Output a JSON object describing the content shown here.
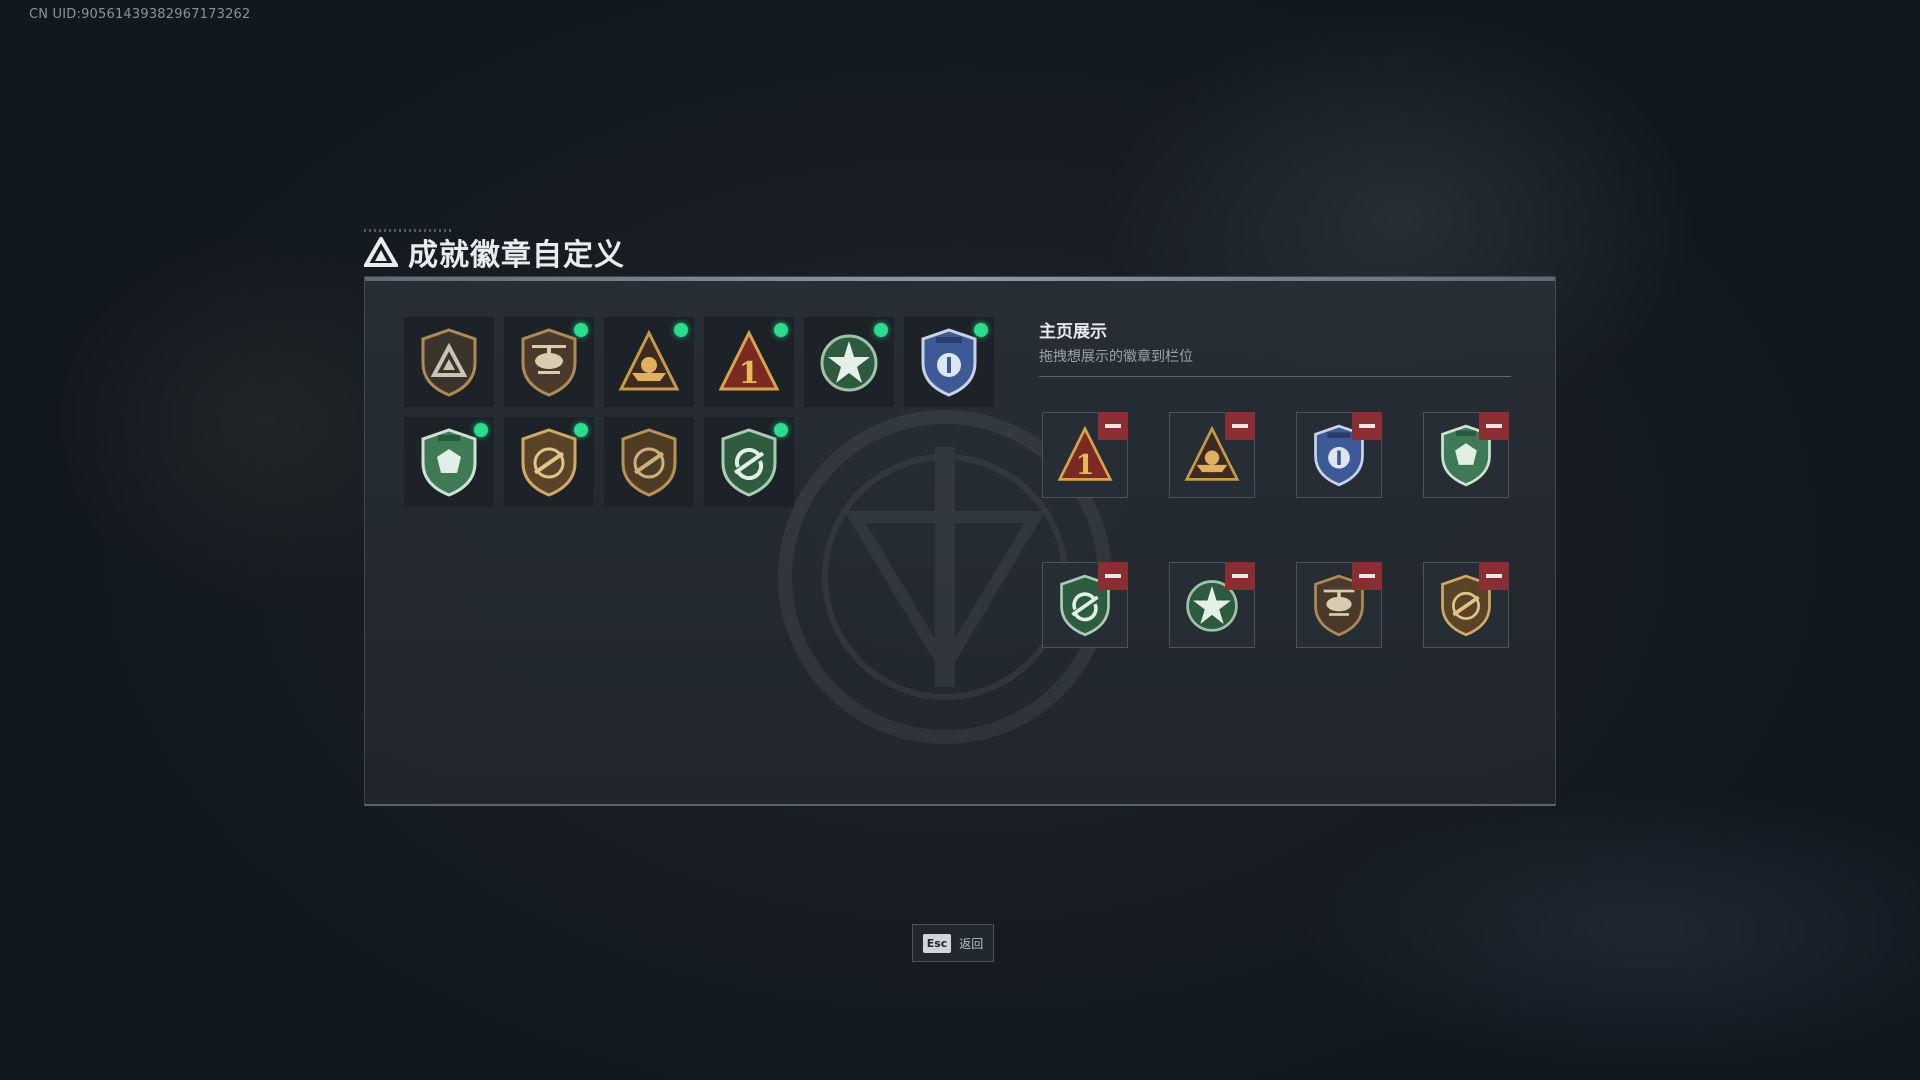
{
  "uid_text": "CN UID:9056143938296​7173262",
  "title": "成就徽章自定义",
  "showcase": {
    "title": "主页展示",
    "subtitle": "拖拽想展示的徽章到栏位"
  },
  "esc": {
    "key": "Esc",
    "label": "返回"
  },
  "colors": {
    "new_dot": "#2bdc8c",
    "remove": "#8b2e33",
    "bronze": "#b08a55",
    "green": "#3e7a55",
    "blue": "#3e5a96",
    "red": "#7a2a22"
  },
  "badges": [
    {
      "icon": "bronze-triangle-badge-icon",
      "is_new": false
    },
    {
      "icon": "helicopter-badge-icon",
      "is_new": true
    },
    {
      "icon": "ship-triangle-badge-icon",
      "is_new": true
    },
    {
      "icon": "number-1-triangle-badge-icon",
      "is_new": true
    },
    {
      "icon": "green-star-wings-badge-icon",
      "is_new": true
    },
    {
      "icon": "blue-police-shield-badge-icon",
      "is_new": true
    },
    {
      "icon": "green-gem-shield-badge-icon",
      "is_new": true
    },
    {
      "icon": "bronze-rifle-shield-badge-icon",
      "is_new": true
    },
    {
      "icon": "bronze-rifle-shield-alt-badge-icon",
      "is_new": false
    },
    {
      "icon": "green-recycle-shield-badge-icon",
      "is_new": true
    }
  ],
  "showcase_slots": [
    {
      "icon": "number-1-triangle-badge-icon"
    },
    {
      "icon": "ship-triangle-badge-icon"
    },
    {
      "icon": "blue-police-shield-badge-icon"
    },
    {
      "icon": "green-gem-shield-badge-icon"
    },
    {
      "icon": "green-recycle-shield-badge-icon"
    },
    {
      "icon": "green-star-wings-badge-icon"
    },
    {
      "icon": "helicopter-badge-icon"
    },
    {
      "icon": "bronze-rifle-shield-badge-icon"
    }
  ]
}
